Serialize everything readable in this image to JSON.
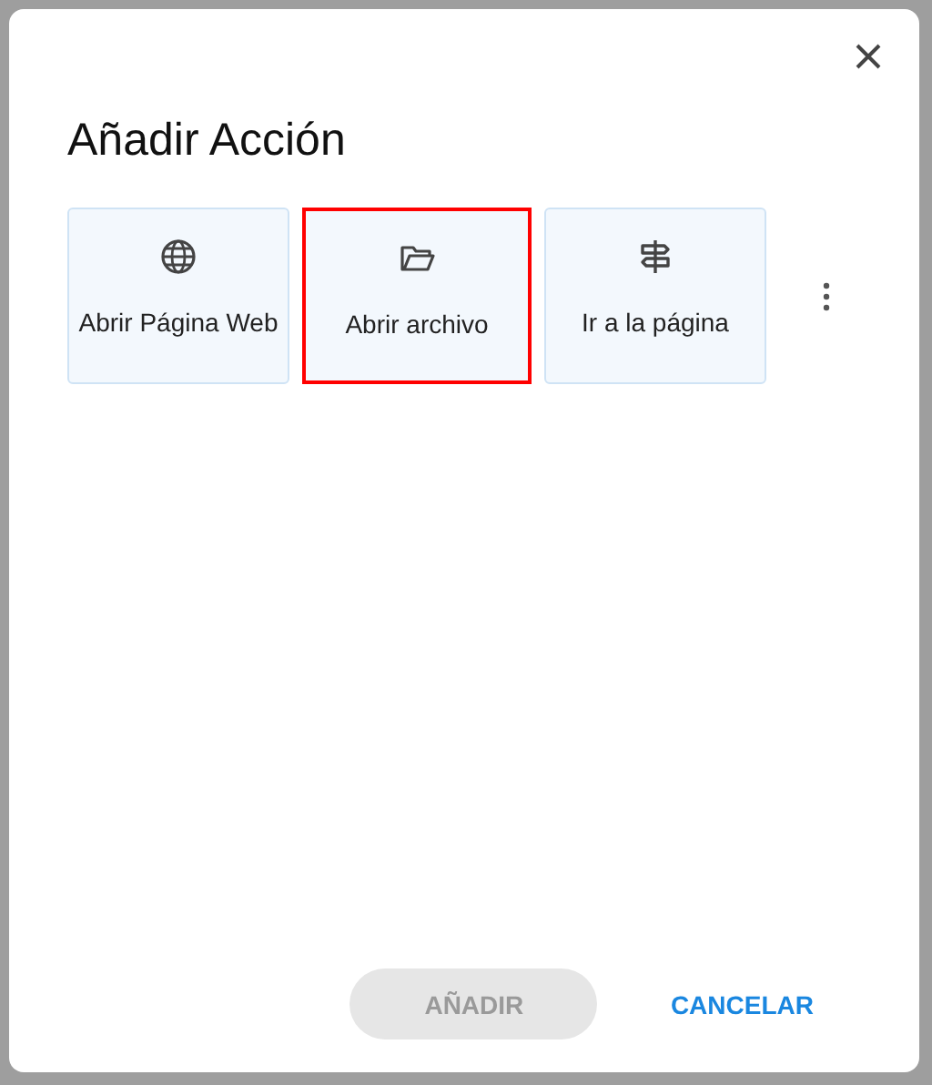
{
  "dialog": {
    "title": "Añadir Acción"
  },
  "actions": [
    {
      "label": "Abrir Página Web",
      "kind": "web",
      "selected": false
    },
    {
      "label": "Abrir archivo",
      "kind": "file",
      "selected": true
    },
    {
      "label": "Ir a la página",
      "kind": "page",
      "selected": false
    }
  ],
  "buttons": [
    {
      "label": "AÑADIR",
      "kind": "filled",
      "disabled": true
    },
    {
      "label": "CANCELAR",
      "kind": "text",
      "disabled": false
    }
  ]
}
